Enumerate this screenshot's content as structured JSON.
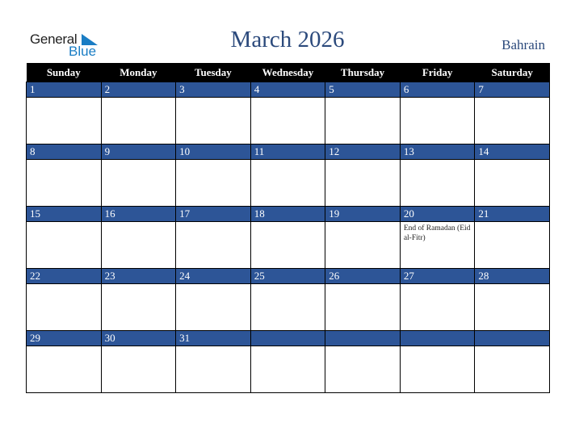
{
  "logo": {
    "line1": "General",
    "line2": "Blue"
  },
  "header": {
    "title": "March 2026",
    "country": "Bahrain"
  },
  "weekdays": [
    "Sunday",
    "Monday",
    "Tuesday",
    "Wednesday",
    "Thursday",
    "Friday",
    "Saturday"
  ],
  "weeks": [
    [
      {
        "d": "1"
      },
      {
        "d": "2"
      },
      {
        "d": "3"
      },
      {
        "d": "4"
      },
      {
        "d": "5"
      },
      {
        "d": "6"
      },
      {
        "d": "7"
      }
    ],
    [
      {
        "d": "8"
      },
      {
        "d": "9"
      },
      {
        "d": "10"
      },
      {
        "d": "11"
      },
      {
        "d": "12"
      },
      {
        "d": "13"
      },
      {
        "d": "14"
      }
    ],
    [
      {
        "d": "15"
      },
      {
        "d": "16"
      },
      {
        "d": "17"
      },
      {
        "d": "18"
      },
      {
        "d": "19"
      },
      {
        "d": "20",
        "event": "End of Ramadan (Eid al-Fitr)"
      },
      {
        "d": "21"
      }
    ],
    [
      {
        "d": "22"
      },
      {
        "d": "23"
      },
      {
        "d": "24"
      },
      {
        "d": "25"
      },
      {
        "d": "26"
      },
      {
        "d": "27"
      },
      {
        "d": "28"
      }
    ],
    [
      {
        "d": "29"
      },
      {
        "d": "30"
      },
      {
        "d": "31"
      },
      {
        "d": ""
      },
      {
        "d": ""
      },
      {
        "d": ""
      },
      {
        "d": ""
      }
    ]
  ],
  "colors": {
    "accent": "#2d5597",
    "title": "#2c4a7c",
    "logo_blue": "#1a7dc4"
  }
}
